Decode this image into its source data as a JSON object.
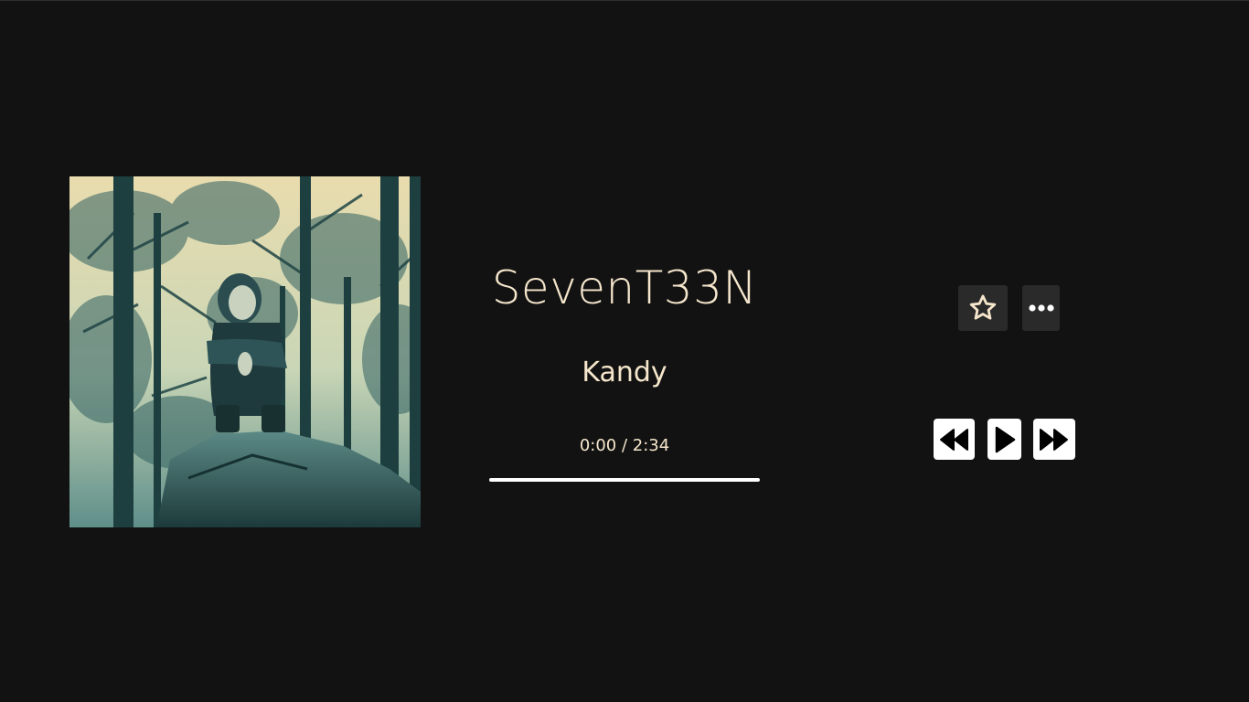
{
  "player": {
    "artist": "SevenT33N",
    "title": "Kandy",
    "time_display": "0:00 / 2:34",
    "progress_fraction": 0.0
  },
  "icons": {
    "favorite": "star-icon",
    "more": "more-horizontal-icon",
    "rewind": "rewind-icon",
    "play": "play-icon",
    "fast_forward": "fast-forward-icon"
  },
  "colors": {
    "background": "#121212",
    "text": "#f5e6cc",
    "button_dark": "#2a2a2a",
    "button_light": "#ffffff"
  }
}
